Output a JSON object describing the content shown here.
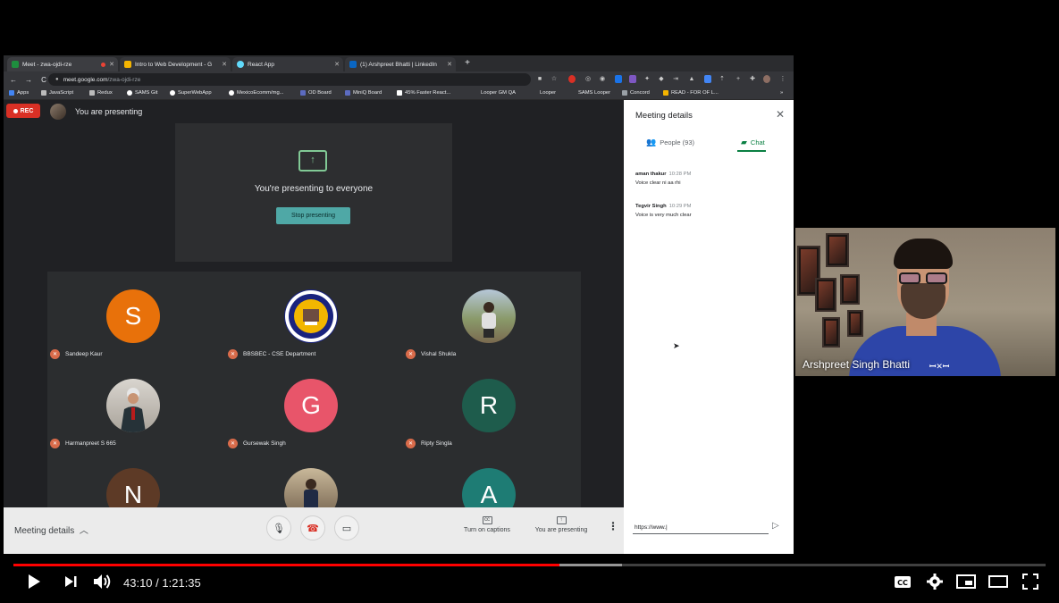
{
  "browser": {
    "tabs": [
      {
        "label": "Meet - zwa-ojdi-rze",
        "favicon_color": "#1e8e3e",
        "active": true
      },
      {
        "label": "Intro to Web Development - G",
        "favicon_color": "#f4b400",
        "active": false
      },
      {
        "label": "React App",
        "favicon_color": "#61dafb",
        "active": false
      },
      {
        "label": "(1) Arshpreet Bhatti | LinkedIn",
        "favicon_color": "#0a66c2",
        "active": false
      }
    ],
    "tab_close_glyph": "✕",
    "new_tab_glyph": "+",
    "url_host": "meet.google.com",
    "url_path": "/zwa-ojdi-rze",
    "bookmarks": [
      "Apps",
      "JavaScript",
      "Redux",
      "SAMS Git",
      "SuperWebApp",
      "MexicoEcomm/mg...",
      "OD Board",
      "MiniQ Board",
      "45% Faster React...",
      "Looper GM QA",
      "Looper",
      "SAMS Looper",
      "Concord",
      "READ - FOR OF L...",
      "»"
    ]
  },
  "meet": {
    "rec_label": "REC",
    "presenting_label": "You are presenting",
    "present_box_title": "You're presenting to everyone",
    "stop_presenting_label": "Stop presenting",
    "present_icon_glyph": "↑",
    "participants": [
      {
        "name": "Sandeep Kaur",
        "initial": "S",
        "color": "#e8710a",
        "photo": false
      },
      {
        "name": "BBSBEC - CSE Department",
        "initial": "",
        "color": "#f2b600",
        "photo": true
      },
      {
        "name": "Vishal Shukla",
        "initial": "",
        "color": "#9b8a6a",
        "photo": true
      },
      {
        "name": "Harmanpreet S 665",
        "initial": "",
        "color": "#c7c2bb",
        "photo": true
      },
      {
        "name": "Gursewak Singh",
        "initial": "G",
        "color": "#e8556a",
        "photo": false
      },
      {
        "name": "Ripty Singla",
        "initial": "R",
        "color": "#1e5c4c",
        "photo": false
      },
      {
        "name": "",
        "initial": "N",
        "color": "#5d3a26",
        "photo": false
      },
      {
        "name": "",
        "initial": "",
        "color": "#8b7a66",
        "photo": true
      },
      {
        "name": "",
        "initial": "A",
        "color": "#1e7c74",
        "photo": false
      }
    ],
    "bottom_bar": {
      "meeting_details_label": "Meeting details",
      "captions_label": "Turn on captions",
      "presenting_label": "You are presenting"
    }
  },
  "panel": {
    "title": "Meeting details",
    "people_tab": "People (93)",
    "chat_tab": "Chat",
    "messages": [
      {
        "sender": "aman thakur",
        "time": "10:28 PM",
        "text": "Voice clear ni aa rhi"
      },
      {
        "sender": "Tegvir Singh",
        "time": "10:29 PM",
        "text": "Voice is very much clear"
      }
    ],
    "input_value": "https://www."
  },
  "webcam": {
    "name": "Arshpreet Singh Bhatti"
  },
  "player": {
    "current_time": "43:10",
    "duration": "1:21:35",
    "played_fraction": 0.529,
    "buffered_fraction": 0.59
  },
  "colors": {
    "progress_red": "#ff0000",
    "meet_green": "#0b8043",
    "stop_button": "#4fa8a6",
    "rec_red": "#d93025"
  }
}
